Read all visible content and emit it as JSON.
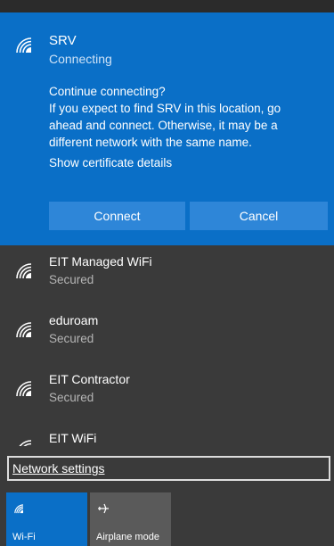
{
  "expanded_network": {
    "name": "SRV",
    "status": "Connecting",
    "message_lines": [
      "Continue connecting?",
      "If you expect to find SRV in this location, go",
      "ahead and connect. Otherwise, it may be a",
      "different network with the same name."
    ],
    "certificate_link": "Show certificate details",
    "connect_label": "Connect",
    "cancel_label": "Cancel",
    "icon": "wifi-icon"
  },
  "networks": [
    {
      "name": "EIT Managed WiFi",
      "status": "Secured",
      "icon": "wifi-icon"
    },
    {
      "name": "eduroam",
      "status": "Secured",
      "icon": "wifi-icon"
    },
    {
      "name": "EIT Contractor",
      "status": "Secured",
      "icon": "wifi-icon"
    },
    {
      "name": "EIT WiFi",
      "status": "",
      "icon": "wifi-icon"
    }
  ],
  "settings_link": "Network settings",
  "quick_actions": [
    {
      "label": "Wi-Fi",
      "icon": "wifi-icon",
      "active": true
    },
    {
      "label": "Airplane mode",
      "icon": "airplane-icon",
      "active": false
    }
  ],
  "colors": {
    "accent": "#0a6fc7",
    "button": "#2e86d8",
    "panel_bg": "#3a3a3a",
    "secondary_text": "#b5b5b5"
  }
}
